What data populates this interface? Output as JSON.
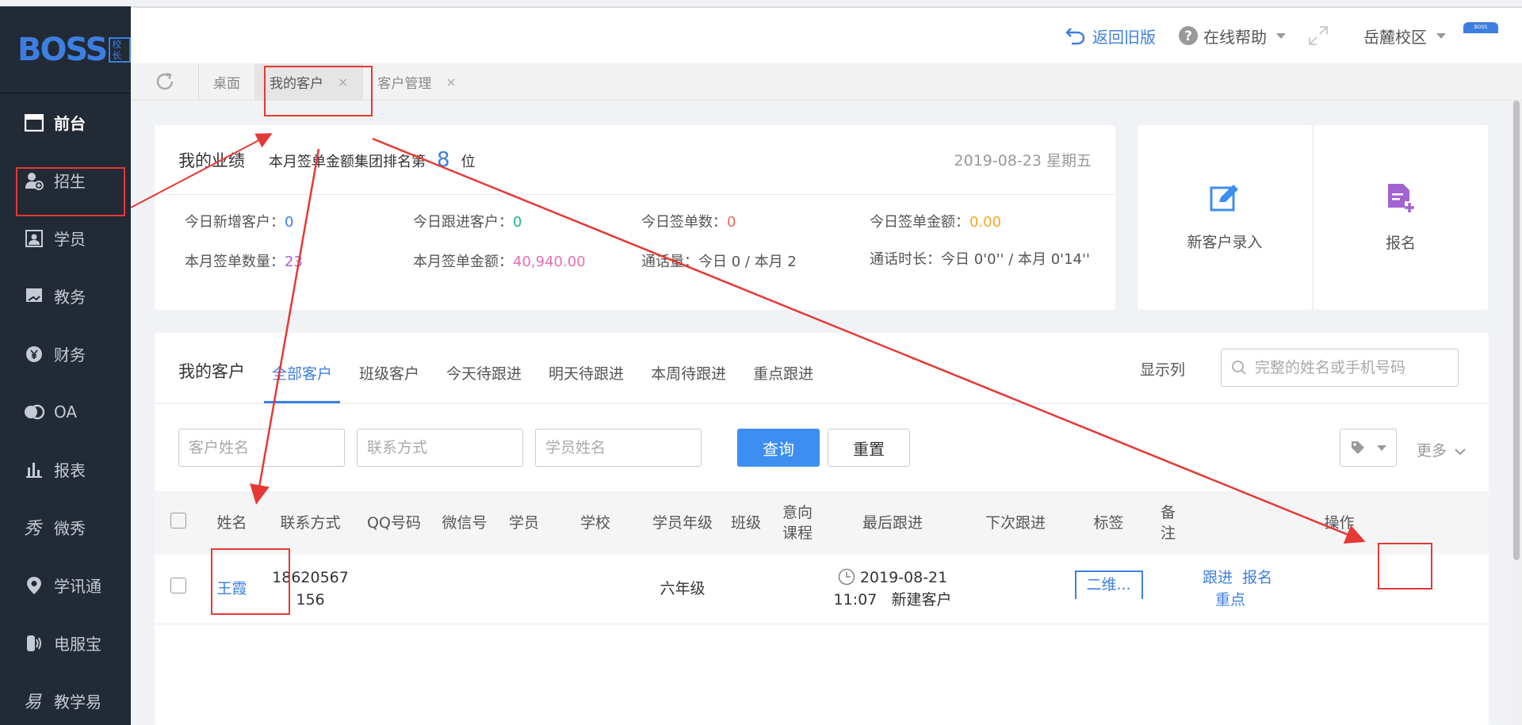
{
  "logo": {
    "brand": "BOSS",
    "sub": "校长"
  },
  "sidebar": {
    "items": [
      {
        "label": "前台",
        "icon": "window-icon",
        "active": true
      },
      {
        "label": "招生",
        "icon": "user-add-icon"
      },
      {
        "label": "学员",
        "icon": "id-card-icon"
      },
      {
        "label": "教务",
        "icon": "book-icon"
      },
      {
        "label": "财务",
        "icon": "yen-icon"
      },
      {
        "label": "OA",
        "icon": "toggle-icon"
      },
      {
        "label": "报表",
        "icon": "bar-chart-icon"
      },
      {
        "label": "微秀",
        "icon": "xiu-icon"
      },
      {
        "label": "学讯通",
        "icon": "location-icon"
      },
      {
        "label": "电服宝",
        "icon": "phone-icon"
      },
      {
        "label": "教学易",
        "icon": "teach-icon"
      }
    ]
  },
  "topbar": {
    "back_old": "返回旧版",
    "help": "在线帮助",
    "campus": "岳麓校区",
    "badge": "BOSS"
  },
  "tabs": [
    {
      "label": "桌面"
    },
    {
      "label": "我的客户",
      "active": true,
      "close": "×"
    },
    {
      "label": "客户管理",
      "close": "×"
    }
  ],
  "performance": {
    "title": "我的业绩",
    "rank_prefix": "本月签单金额集团排名第",
    "rank_value": "8",
    "rank_suffix": "位",
    "date": "2019-08-23 星期五",
    "stats": [
      {
        "label": "今日新增客户：",
        "value": "0"
      },
      {
        "label": "今日跟进客户：",
        "value": "0"
      },
      {
        "label": "今日签单数：",
        "value": "0"
      },
      {
        "label": "今日签单金额：",
        "value": "0.00"
      },
      {
        "label": "本月签单数量：",
        "value": "23"
      },
      {
        "label": "本月签单金额：",
        "value": "40,940.00"
      },
      {
        "label": "通话量：",
        "value": "今日 0 / 本月 2"
      },
      {
        "label": "通话时长：",
        "value": "今日 0'0'' / 本月 0'14''"
      }
    ]
  },
  "quick": {
    "new_customer": "新客户录入",
    "enroll": "报名",
    "accent": "#3d8ef0",
    "enroll_accent": "#a262d1"
  },
  "customers": {
    "title": "我的客户",
    "tabs": [
      "全部客户",
      "班级客户",
      "今天待跟进",
      "明天待跟进",
      "本周待跟进",
      "重点跟进"
    ],
    "show_columns": "显示列",
    "search_placeholder": "完整的姓名或手机号码",
    "filters": {
      "name_placeholder": "客户姓名",
      "contact_placeholder": "联系方式",
      "student_placeholder": "学员姓名",
      "query": "查询",
      "reset": "重置",
      "more": "更多"
    },
    "columns": [
      "姓名",
      "联系方式",
      "QQ号码",
      "微信号",
      "学员",
      "学校",
      "学员年级",
      "班级",
      "意向课程",
      "最后跟进",
      "下次跟进",
      "标签",
      "备注",
      "操作"
    ],
    "rows": [
      {
        "name": "王霞",
        "phone": "18620567156",
        "grade": "六年级",
        "last_follow_date": "2019-08-21",
        "last_follow_time": "11:07",
        "last_follow_note": "新建客户",
        "tag": "二维...",
        "action_follow": "跟进",
        "action_enroll": "报名",
        "action_key": "重点"
      }
    ]
  },
  "annotation_color": "#e53935"
}
